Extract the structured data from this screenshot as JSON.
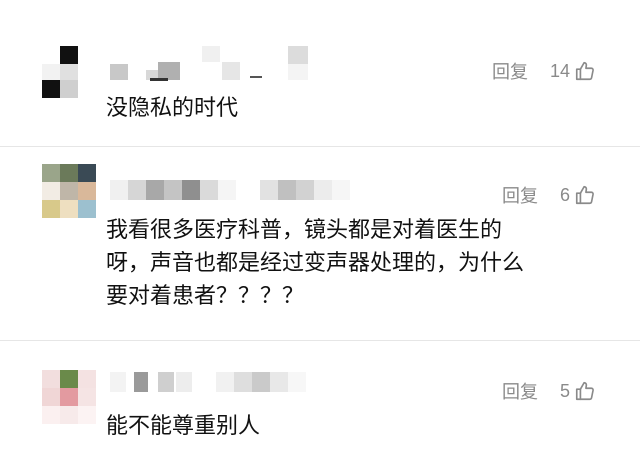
{
  "comments": [
    {
      "reply_label": "回复",
      "like_count": "14",
      "text_lines": [
        "没隐私的时代"
      ]
    },
    {
      "reply_label": "回复",
      "like_count": "6",
      "text_lines": [
        "我看很多医疗科普，镜头都是对着医生的",
        "呀，声音也都是经过变声器处理的，为什么",
        "要对着患者？？？？"
      ]
    },
    {
      "reply_label": "回复",
      "like_count": "5",
      "text_lines": [
        "能不能尊重别人"
      ]
    }
  ],
  "icons": {
    "like": "thumbs-up-icon"
  },
  "colors": {
    "secondary_text": "#8a8a8a",
    "body_text": "#111111"
  }
}
